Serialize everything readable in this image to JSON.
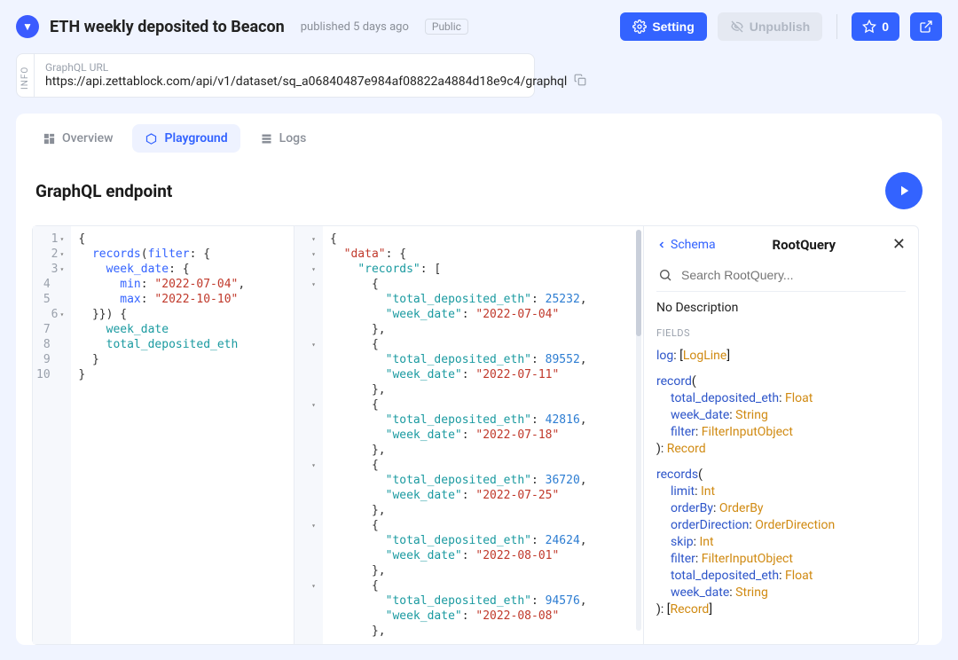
{
  "header": {
    "title": "ETH weekly deposited to Beacon",
    "published": "published 5 days ago",
    "visibility": "Public",
    "setting": "Setting",
    "unpublish": "Unpublish",
    "star_count": "0"
  },
  "info": {
    "tab": "INFO",
    "label": "GraphQL URL",
    "url": "https://api.zettablock.com/api/v1/dataset/sq_a06840487e984af08822a4884d18e9c4/graphql"
  },
  "tabs": {
    "overview": "Overview",
    "playground": "Playground",
    "logs": "Logs"
  },
  "section": {
    "title": "GraphQL endpoint"
  },
  "query": {
    "l1": "{",
    "l2a": "records",
    "l2b": "filter",
    "l2c": ": {",
    "l3a": "week_date",
    "l3b": ": {",
    "l4a": "min",
    "l4b": "\"2022-07-04\"",
    "l5a": "max",
    "l5b": "\"2022-10-10\"",
    "l6": "}}) {",
    "l7": "week_date",
    "l8": "total_deposited_eth",
    "l9": "}",
    "l10": "}"
  },
  "response": {
    "open1": "{",
    "dataKey": "\"data\"",
    "open2": ": {",
    "recordsKey": "\"records\"",
    "open3": ": [",
    "rows": [
      {
        "eth": "25232",
        "date": "\"2022-07-04\""
      },
      {
        "eth": "89552",
        "date": "\"2022-07-11\""
      },
      {
        "eth": "42816",
        "date": "\"2022-07-18\""
      },
      {
        "eth": "36720",
        "date": "\"2022-07-25\""
      },
      {
        "eth": "24624",
        "date": "\"2022-08-01\""
      },
      {
        "eth": "94576",
        "date": "\"2022-08-08\""
      }
    ],
    "ethKey": "\"total_deposited_eth\"",
    "dateKey": "\"week_date\""
  },
  "schema": {
    "back": "Schema",
    "title": "RootQuery",
    "placeholder": "Search RootQuery...",
    "desc": "No Description",
    "fieldsLabel": "FIELDS",
    "log": {
      "name": "log",
      "type": "LogLine"
    },
    "record": {
      "name": "record",
      "args": [
        {
          "n": "total_deposited_eth",
          "t": "Float"
        },
        {
          "n": "week_date",
          "t": "String"
        },
        {
          "n": "filter",
          "t": "FilterInputObject"
        }
      ],
      "ret": "Record"
    },
    "records": {
      "name": "records",
      "args": [
        {
          "n": "limit",
          "t": "Int"
        },
        {
          "n": "orderBy",
          "t": "OrderBy"
        },
        {
          "n": "orderDirection",
          "t": "OrderDirection"
        },
        {
          "n": "skip",
          "t": "Int"
        },
        {
          "n": "filter",
          "t": "FilterInputObject"
        },
        {
          "n": "total_deposited_eth",
          "t": "Float"
        },
        {
          "n": "week_date",
          "t": "String"
        }
      ],
      "ret": "Record"
    }
  }
}
